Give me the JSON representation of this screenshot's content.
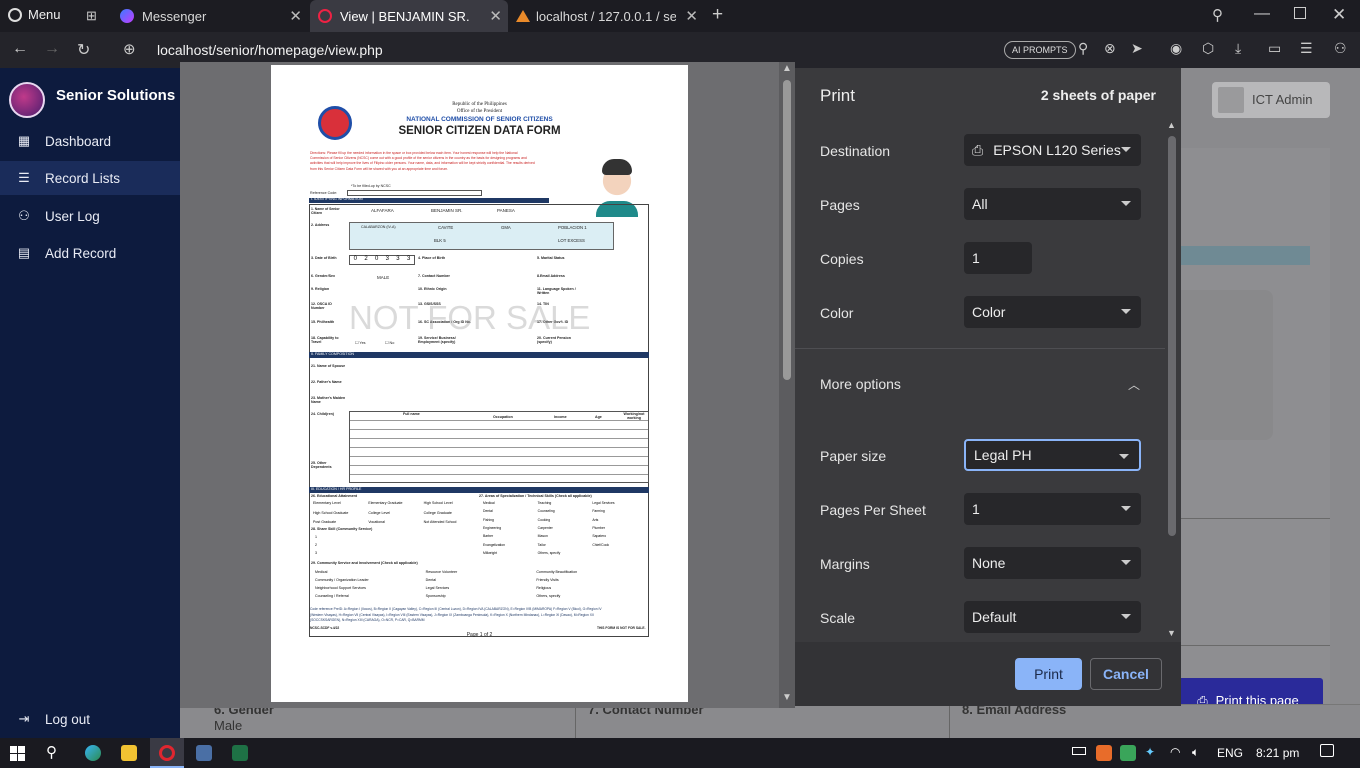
{
  "browser": {
    "menu_label": "Menu",
    "tabs": [
      {
        "label": "Messenger"
      },
      {
        "label": "View | BENJAMIN SR."
      },
      {
        "label": "localhost / 127.0.0.1 / senio"
      }
    ],
    "url": "localhost/senior/homepage/view.php",
    "ai_prompts": "AI PROMPTS"
  },
  "sidebar": {
    "brand": "Senior Solutions",
    "items": [
      {
        "label": "Dashboard",
        "icon": "grid-icon"
      },
      {
        "label": "Record Lists",
        "icon": "list-icon"
      },
      {
        "label": "User Log",
        "icon": "user-icon"
      },
      {
        "label": "Add Record",
        "icon": "box-icon"
      }
    ],
    "logout": "Log out"
  },
  "header": {
    "user": "ICT Admin"
  },
  "page": {
    "fields": [
      {
        "label": "6. Gender",
        "value": "Male"
      },
      {
        "label": "7. Contact Number",
        "value": ""
      },
      {
        "label": "8. Email Address",
        "value": ""
      }
    ],
    "print_page_button": "Print this page"
  },
  "form": {
    "header1": "Republic of the Philippines",
    "header2": "Office of the President",
    "agency": "NATIONAL COMMISSION OF SENIOR CITIZENS",
    "title": "SENIOR CITIZEN DATA FORM",
    "watermark": "NOT FOR SALE",
    "directions": "Directions: Please fill up the needed information in the space or box provided below each item. Your honest response will help the National Commission of Senior Citizens (NCSC) come out with a good profile of the senior citizens in the country as the basis for designing programs and activities that will help improve the lives of Filipino older persons. Your name, data, and information will be kept strictly confidential. The results derived from this Senior Citizen Data Form will be shared with you at an appropriate time and forum.",
    "ncsc_note": "*To be filled-up by NCSC",
    "ref_code": "Reference Code:",
    "sec1": "I. IDENTIFYING INFORMATION",
    "name_label": "1. Name of Senior Citizen",
    "name_values": [
      "ALFAFARA",
      "BENJAMIN SR.",
      "PANESA",
      ""
    ],
    "name_subs": [
      "Last Name",
      "First Name",
      "Middle Name",
      "Extension (Jr, Sr)"
    ],
    "address_label": "2. Address",
    "addr_values": [
      "CALABARZON (IV-A)",
      "CAVITE",
      "GMA",
      "POBLACION 1"
    ],
    "addr_subs": [
      "Region",
      "Province",
      "City/Municipality",
      "Barangay"
    ],
    "addr2_values": [
      "BLK 5",
      "LOT EXCESS"
    ],
    "addr2_subs": [
      "House No./Zone/Purok/Sitio",
      "Street"
    ],
    "dob_label": "3. Date of Birth",
    "dob_digits": [
      "0",
      "2",
      "0",
      "3",
      "3",
      "3"
    ],
    "dob_subs": [
      "m",
      "m",
      "d",
      "d",
      "y",
      "y"
    ],
    "pob": "4. Place of Birth",
    "marital": "5. Marital Status",
    "gender": "6. Gender/Sex",
    "gender_value": "MALE",
    "contact": "7. Contact Number",
    "email": "8.Email Address",
    "religion": "9. Religion",
    "ethnic": "10. Ethnic Origin",
    "language": "11. Language Spoken / Written",
    "osca": "12. OSCA ID Number",
    "gsis": "13. GSIS/SSS",
    "tin": "14. TIN",
    "philhealth": "15. Philhealth",
    "assoc": "16. SC Association / Org ID No.",
    "otherid": "17. Other Gov't. ID",
    "capability": "18. Capability to Travel",
    "yes": "Yes",
    "no": "No",
    "service": "19. Service/ Business/ Employment (specify)",
    "pension": "20. Current Pension (specify)",
    "sec2": "II. FAMILY COMPOSITION",
    "spouse": "21. Name of Spouse",
    "father": "22. Father's Name",
    "mother": "23. Mother's Maiden Name",
    "children": "24. Child(ren)",
    "child_heads": [
      "Full name",
      "Occupation",
      "Income",
      "Age",
      "Working/not working"
    ],
    "other_dep": "25. Other Dependents",
    "sec3": "III. EDUCATION / HR PROFILE",
    "edu_label": "26. Educational Attainment",
    "edu_options": [
      "Elementary Level",
      "Elementary Graduate",
      "High School Level",
      "High School Graduate",
      "College Level",
      "College Graduate",
      "Post Graduate",
      "Vocational",
      "Not Attended School"
    ],
    "skills_label": "27. Areas of Specialization / Technical Skills (Check all applicable)",
    "skills_col1": [
      "Medical",
      "Dental",
      "Fishing",
      "Engineering",
      "Barber",
      "Evangelization",
      "Millwright"
    ],
    "skills_col2": [
      "Teaching",
      "Counseling",
      "Cooking",
      "Carpenter",
      "Mason",
      "Tailor",
      "Others, specify"
    ],
    "skills_col3": [
      "Legal Services",
      "Farming",
      "Arts",
      "Plumber",
      "Sapatero",
      "Chief/Cook"
    ],
    "share_label": "28. Share Skill (Community Service)",
    "share_items": [
      "1",
      "2",
      "3"
    ],
    "community_label": "29. Community Service and Involvement (Check all applicable)",
    "community_col1": [
      "Medical",
      "Community / Organization Leader",
      "Neighborhood Support Services",
      "Counseling / Referral"
    ],
    "community_col2": [
      "Resource Volunteer",
      "Dental",
      "Legal Services",
      "Sponsorship"
    ],
    "community_col3": [
      "Community Beautification",
      "Friendly Visits",
      "Religious",
      "Others, specify"
    ],
    "footer_ref": "Code reference PreID:   A=Region I (Ilocos), B=Region II (Cagayan Valley), C=Region III (Central Luzon), D=Region IVA (CALABARZON), E=Region IVB (MIMAROPA) F=Region V (Bicol), G=Region IV (Western Visayas), H=Region VII (Central Visayas), I=Region VIII (Eastern Visayas), J=Region IX (Zamboanga Peninsula), K=Region X (Northern Mindanao), L=Region XI (Davao), M=Region XII (SOCCSKSARGEN), N=Region XIII (CARAGA), O=NCR, P=CAR, Q=BARMM",
    "form_code": "NCSC-SCDF v.4/22",
    "not_for_sale": "THIS FORM IS NOT FOR SALE.",
    "page_num": "Page 1 of 2"
  },
  "print_dialog": {
    "title": "Print",
    "sheets": "2 sheets of paper",
    "destination_label": "Destination",
    "destination_value": "EPSON L120 Series",
    "pages_label": "Pages",
    "pages_value": "All",
    "copies_label": "Copies",
    "copies_value": "1",
    "color_label": "Color",
    "color_value": "Color",
    "more_options": "More options",
    "paper_size_label": "Paper size",
    "paper_size_value": "Legal PH",
    "pps_label": "Pages Per Sheet",
    "pps_value": "1",
    "margins_label": "Margins",
    "margins_value": "None",
    "scale_label": "Scale",
    "scale_value": "Default",
    "print_button": "Print",
    "cancel_button": "Cancel",
    "accent": "#8ab4f8"
  },
  "taskbar": {
    "lang": "ENG",
    "time": "8:21 pm"
  },
  "colors": {
    "sidebar_bg": "#0d1b3e",
    "print_page_btn": "#2a2a9a",
    "form_section": "#1f3864",
    "form_cell": "#dbeef4"
  }
}
